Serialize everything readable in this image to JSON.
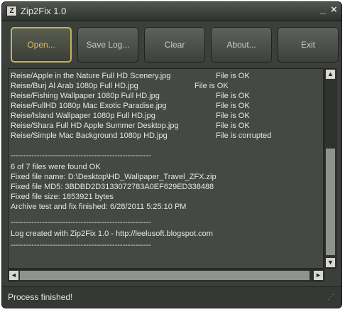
{
  "window": {
    "title": "Zip2Fix 1.0",
    "app_icon": "Z",
    "minimize_glyph": "_",
    "close_glyph": "×"
  },
  "toolbar": {
    "open_label": "Open...",
    "save_log_label": "Save Log...",
    "clear_label": "Clear",
    "about_label": "About...",
    "exit_label": "Exit"
  },
  "log": {
    "files": [
      {
        "name": "Reise/Apple in the Nature Full HD Scenery.jpg",
        "status": "File is OK"
      },
      {
        "name": "Reise/Burj Al Arab 1080p Full HD.jpg",
        "status": "File is OK"
      },
      {
        "name": "Reise/Fishing Wallpaper 1080p Full HD.jpg",
        "status": "File is OK"
      },
      {
        "name": "Reise/FullHD 1080p Mac Exotic Paradise.jpg",
        "status": "File is OK"
      },
      {
        "name": "Reise/Island Wallpaper 1080p Full HD.jpg",
        "status": "File is OK"
      },
      {
        "name": "Reise/Shara Full HD Apple Summer Desktop.jpg",
        "status": "File is OK"
      },
      {
        "name": "Reise/Simple Mac Background 1080p HD.jpg",
        "status": "File is corrupted"
      }
    ],
    "separator": "------------------------------------------------------",
    "summary": [
      "6 of 7 files were found OK",
      "Fixed file name: D:\\Desktop\\HD_Wallpaper_Travel_ZFX.zip",
      "Fixed file MD5: 3BDBD2D3133072783A0EF629ED338488",
      "Fixed file size: 1853921 bytes",
      "Archive test and fix finished: 6/28/2011 5:25:10 PM"
    ],
    "credit": "Log created with Zip2Fix 1.0 - http://leelusoft.blogspot.com"
  },
  "scrollbars": {
    "up_glyph": "▲",
    "down_glyph": "▼",
    "left_glyph": "◄",
    "right_glyph": "►"
  },
  "status_bar": {
    "text": "Process finished!",
    "grip_glyph": "⋰"
  }
}
